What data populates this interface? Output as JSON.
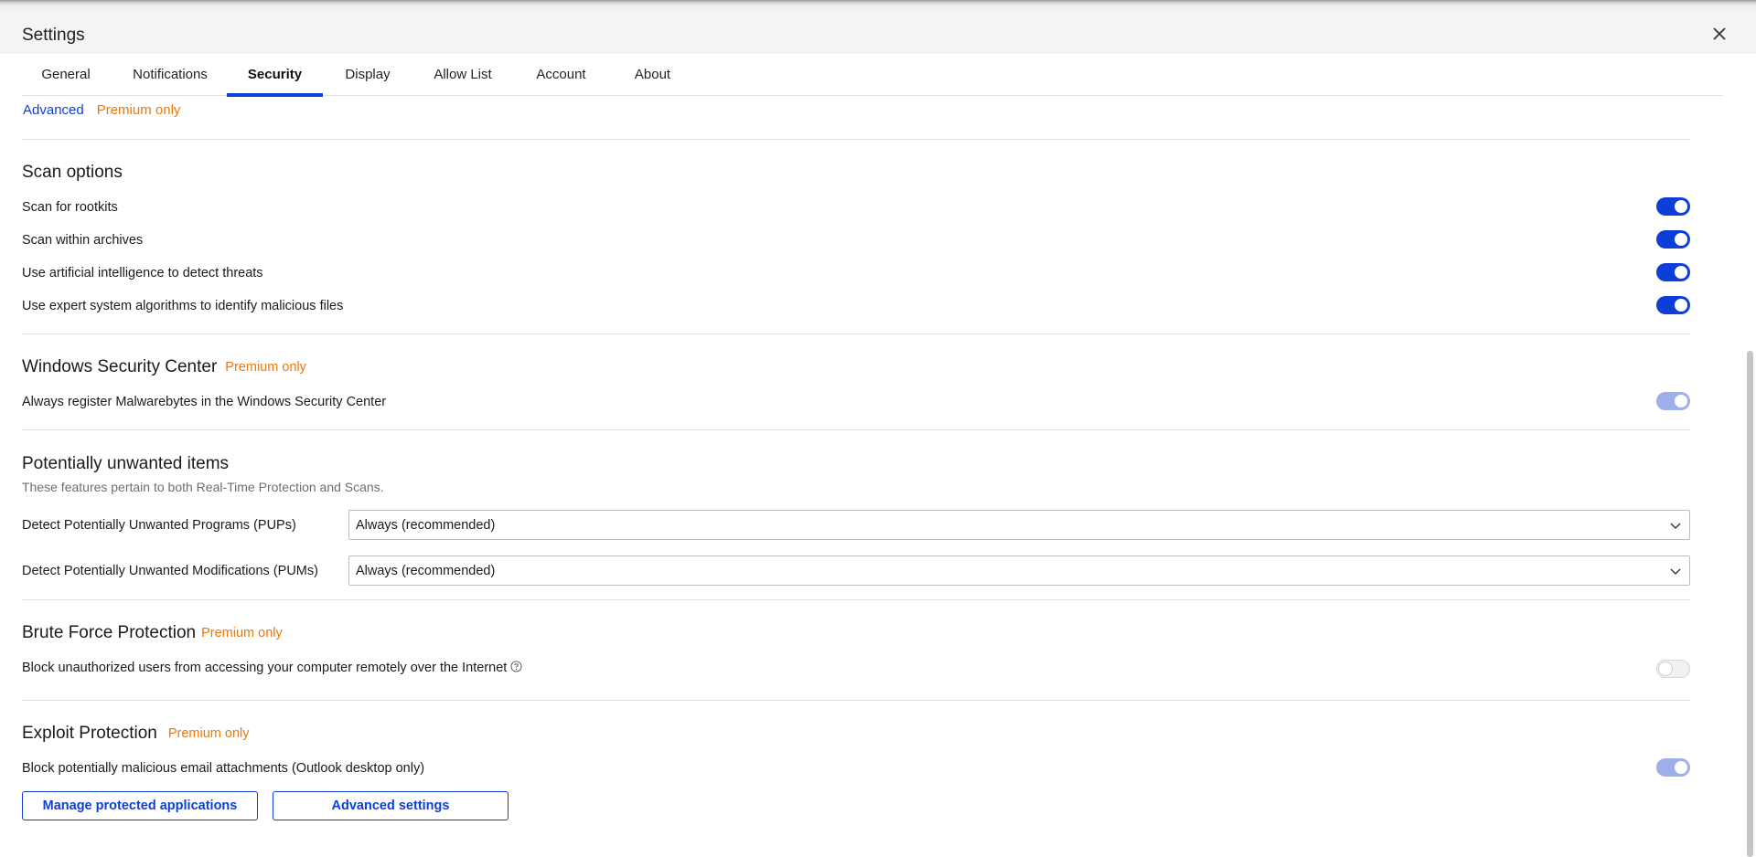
{
  "window": {
    "title": "Settings"
  },
  "tabs": [
    {
      "label": "General"
    },
    {
      "label": "Notifications"
    },
    {
      "label": "Security",
      "active": true
    },
    {
      "label": "Display"
    },
    {
      "label": "Allow List"
    },
    {
      "label": "Account"
    },
    {
      "label": "About"
    }
  ],
  "subnav": {
    "advanced": "Advanced",
    "premium": "Premium only"
  },
  "scan_options": {
    "heading": "Scan options",
    "items": [
      {
        "label": "Scan for rootkits",
        "state": "on"
      },
      {
        "label": "Scan within archives",
        "state": "on"
      },
      {
        "label": "Use artificial intelligence to detect threats",
        "state": "on"
      },
      {
        "label": "Use expert system algorithms to identify malicious files",
        "state": "on"
      }
    ]
  },
  "wsc": {
    "heading": "Windows Security Center",
    "premium": "Premium only",
    "item": {
      "label": "Always register Malwarebytes in the Windows Security Center",
      "state": "on-disabled"
    }
  },
  "pui": {
    "heading": "Potentially unwanted items",
    "description": "These features pertain to both Real-Time Protection and Scans.",
    "pup": {
      "label": "Detect Potentially Unwanted Programs (PUPs)",
      "value": "Always (recommended)"
    },
    "pum": {
      "label": "Detect Potentially Unwanted Modifications (PUMs)",
      "value": "Always (recommended)"
    }
  },
  "brute": {
    "heading": "Brute Force Protection",
    "premium": "Premium only",
    "item": {
      "label": "Block unauthorized users from accessing your computer remotely over the Internet",
      "state": "off-disabled"
    }
  },
  "exploit": {
    "heading": "Exploit Protection",
    "premium": "Premium only",
    "item": {
      "label": "Block potentially malicious email attachments (Outlook desktop only)",
      "state": "on-disabled"
    },
    "buttons": {
      "manage": "Manage protected applications",
      "advanced": "Advanced settings"
    }
  },
  "colors": {
    "accent": "#0d3fd8",
    "premium": "#e8790e",
    "toggle_disabled_on": "#9fb0e8"
  }
}
